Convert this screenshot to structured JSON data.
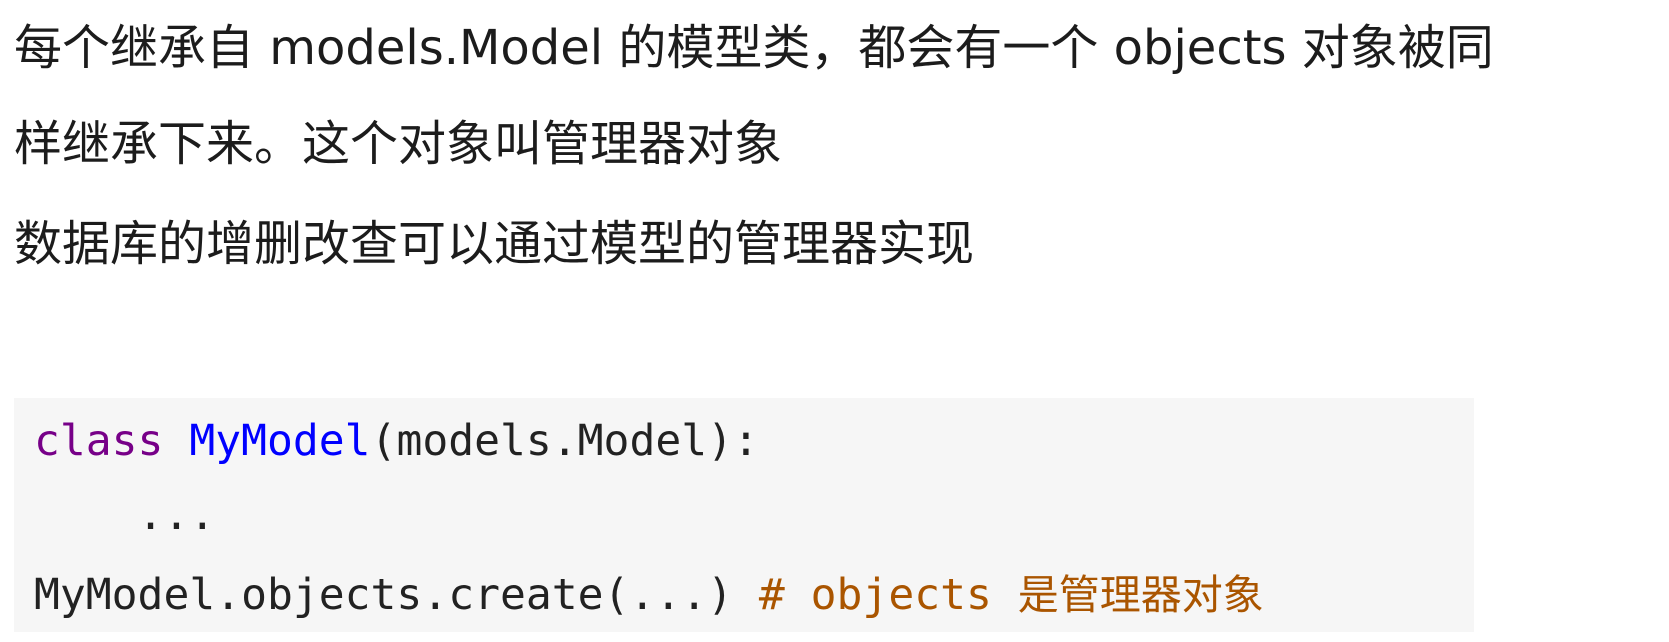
{
  "paragraph_1": {
    "line_1": "每个继承自 models.Model 的模型类，都会有一个 objects 对象被同",
    "line_2": "样继承下来。这个对象叫管理器对象"
  },
  "paragraph_2": {
    "text": "数据库的增删改查可以通过模型的管理器实现"
  },
  "code": {
    "line_1": {
      "keyword": "class",
      "class_name": "MyModel",
      "rest": "(models.Model):"
    },
    "line_2": {
      "text": "..."
    },
    "line_3": {
      "code": "MyModel.objects.create(...) ",
      "comment_code": "# objects ",
      "comment_text": "是管理器对象"
    }
  },
  "colors": {
    "keyword": "#770088",
    "class_name": "#0000ff",
    "comment": "#aa5500",
    "code_background": "#f6f6f6"
  }
}
